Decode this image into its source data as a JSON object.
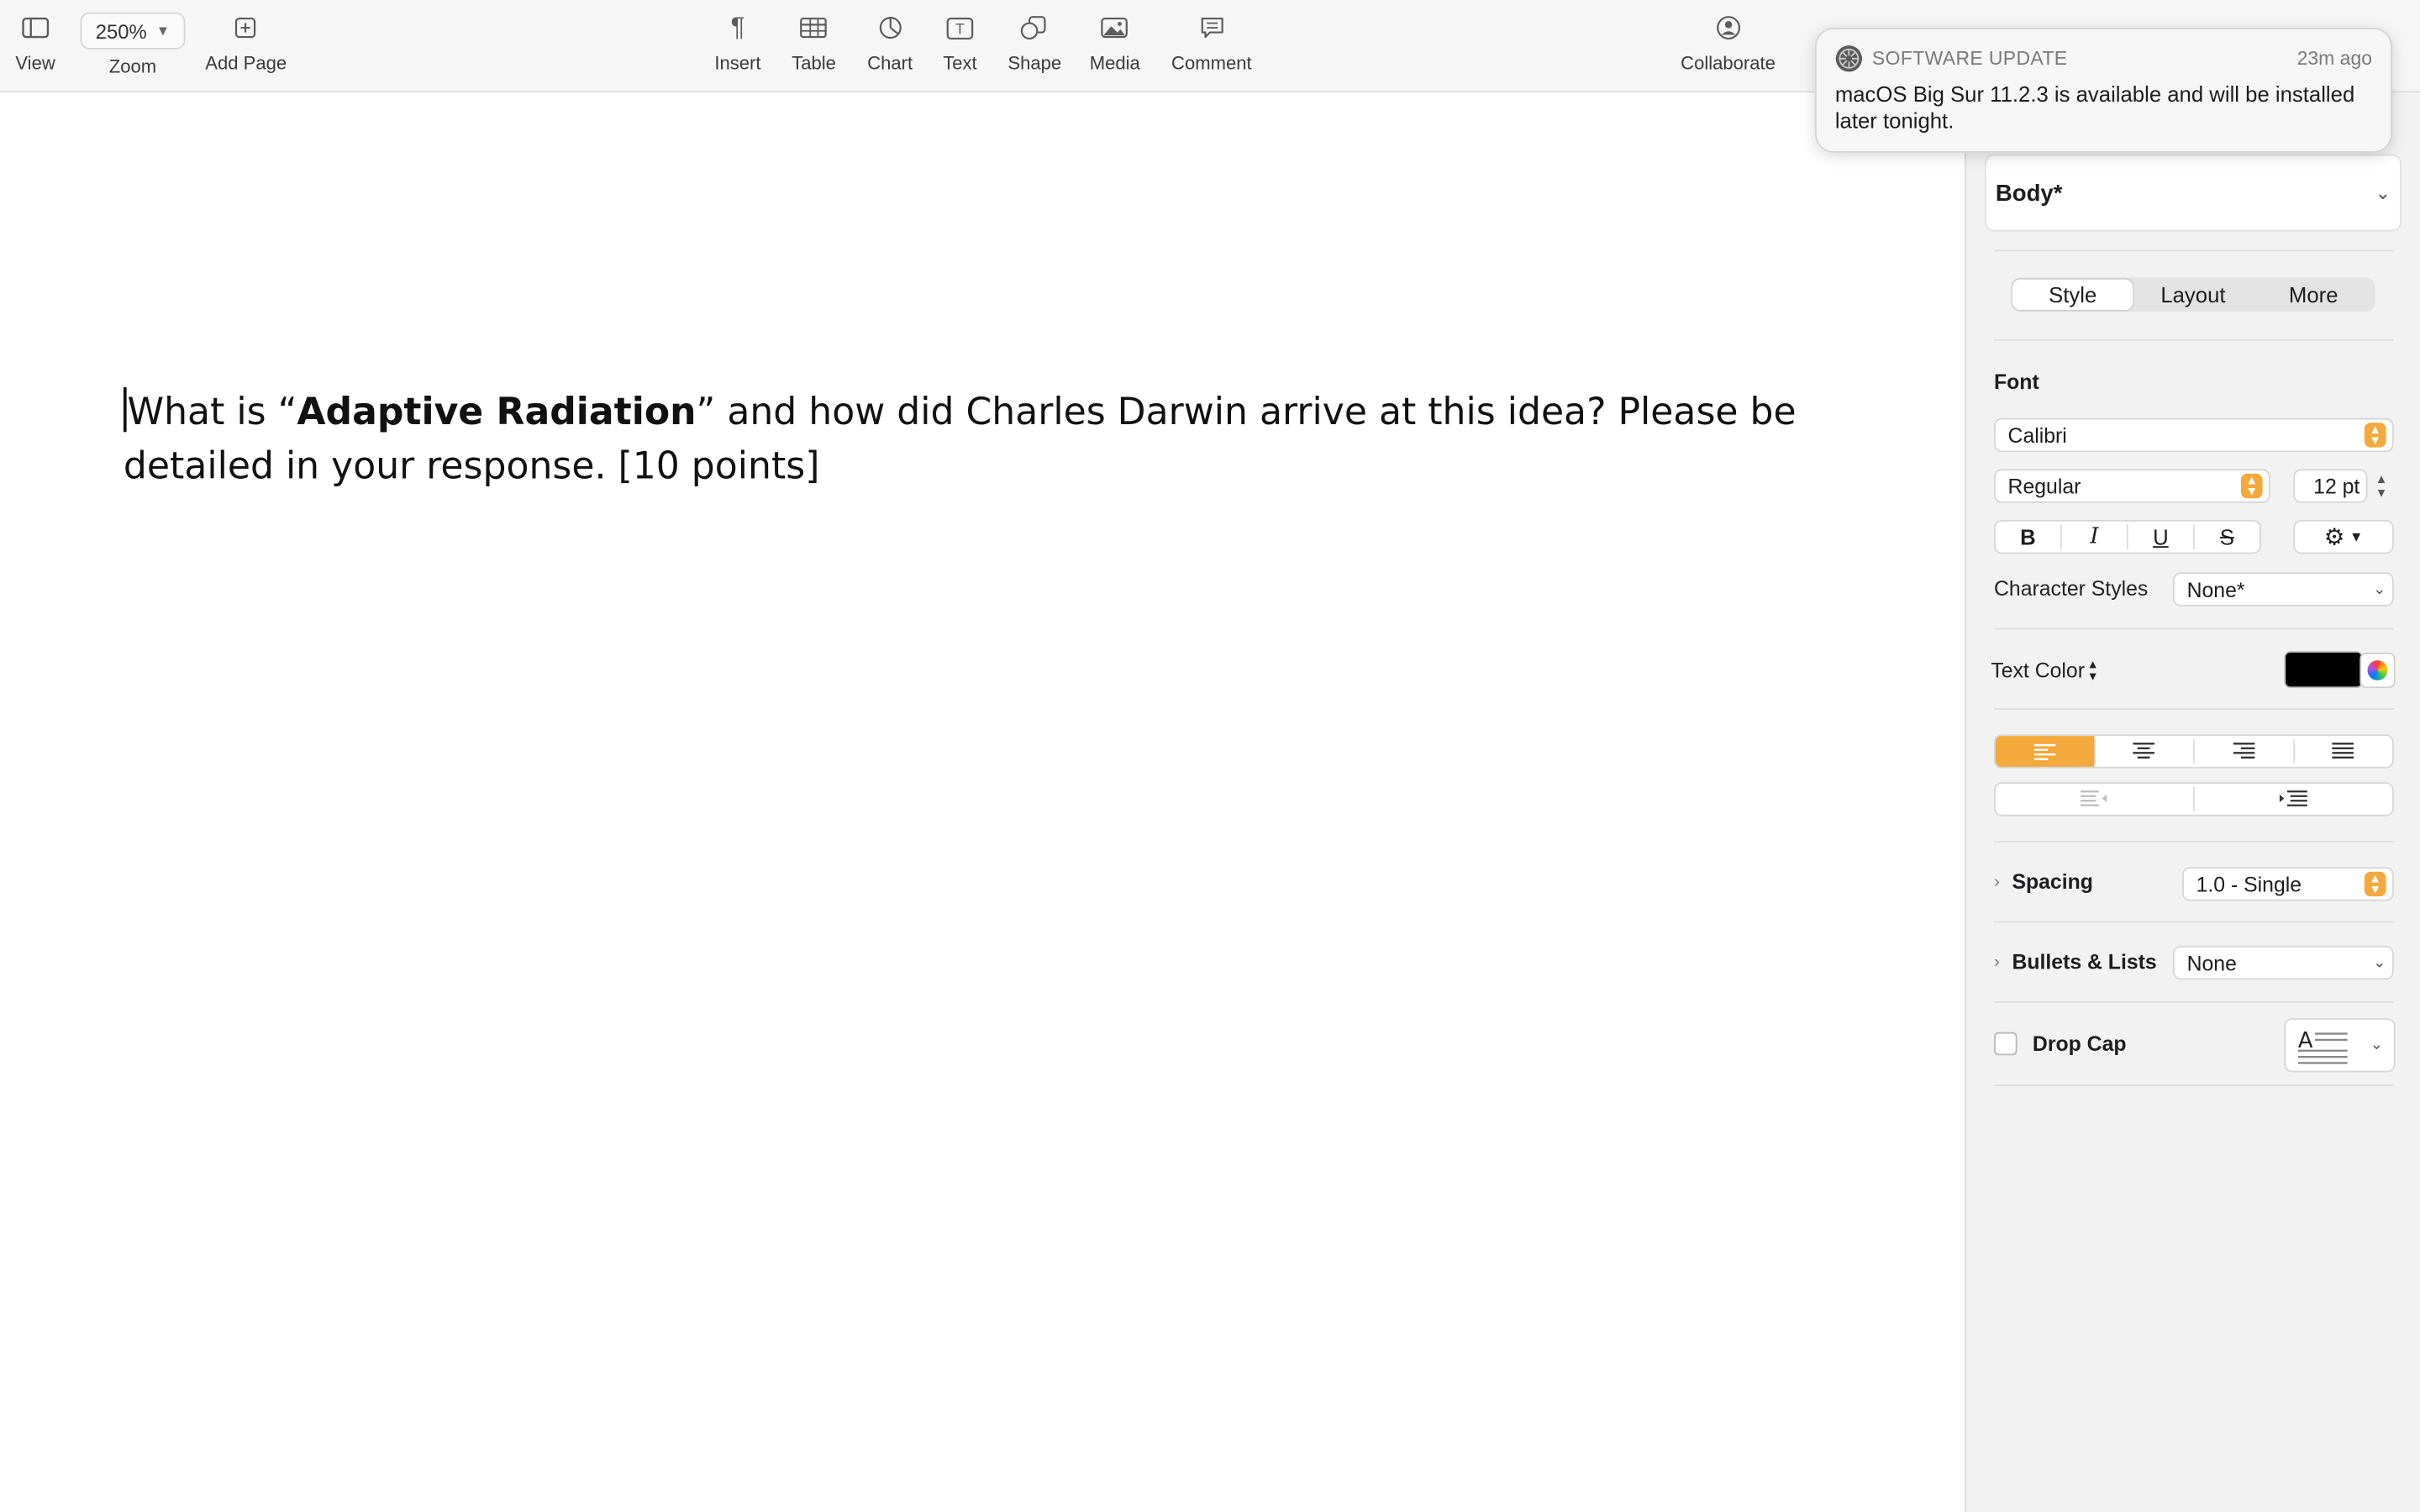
{
  "toolbar": {
    "view": "View",
    "zoom_value": "250%",
    "zoom": "Zoom",
    "add_page": "Add Page",
    "insert": "Insert",
    "table": "Table",
    "chart": "Chart",
    "text": "Text",
    "shape": "Shape",
    "media": "Media",
    "comment": "Comment",
    "collaborate": "Collaborate"
  },
  "document": {
    "part1": "What is “",
    "bold": "Adaptive Radiation",
    "part2": "” and how did Charles Darwin arrive at this idea? Please be detailed in your response. [10 points]"
  },
  "notification": {
    "app": "SOFTWARE UPDATE",
    "time": "23m ago",
    "message": "macOS Big Sur 11.2.3 is available and will be installed later tonight."
  },
  "sidebar": {
    "paragraph_style": "Body*",
    "tabs": [
      "Style",
      "Layout",
      "More"
    ],
    "font_heading": "Font",
    "font_family": "Calibri",
    "font_style": "Regular",
    "font_size": "12 pt",
    "format_buttons": [
      "B",
      "I",
      "U",
      "S"
    ],
    "character_styles_label": "Character Styles",
    "character_styles_value": "None*",
    "text_color_label": "Text Color",
    "text_color": "#000000",
    "spacing_label": "Spacing",
    "spacing_value": "1.0 - Single",
    "bullets_label": "Bullets & Lists",
    "bullets_value": "None",
    "drop_cap_label": "Drop Cap"
  },
  "colors": {
    "accent": "#f4a93c"
  }
}
